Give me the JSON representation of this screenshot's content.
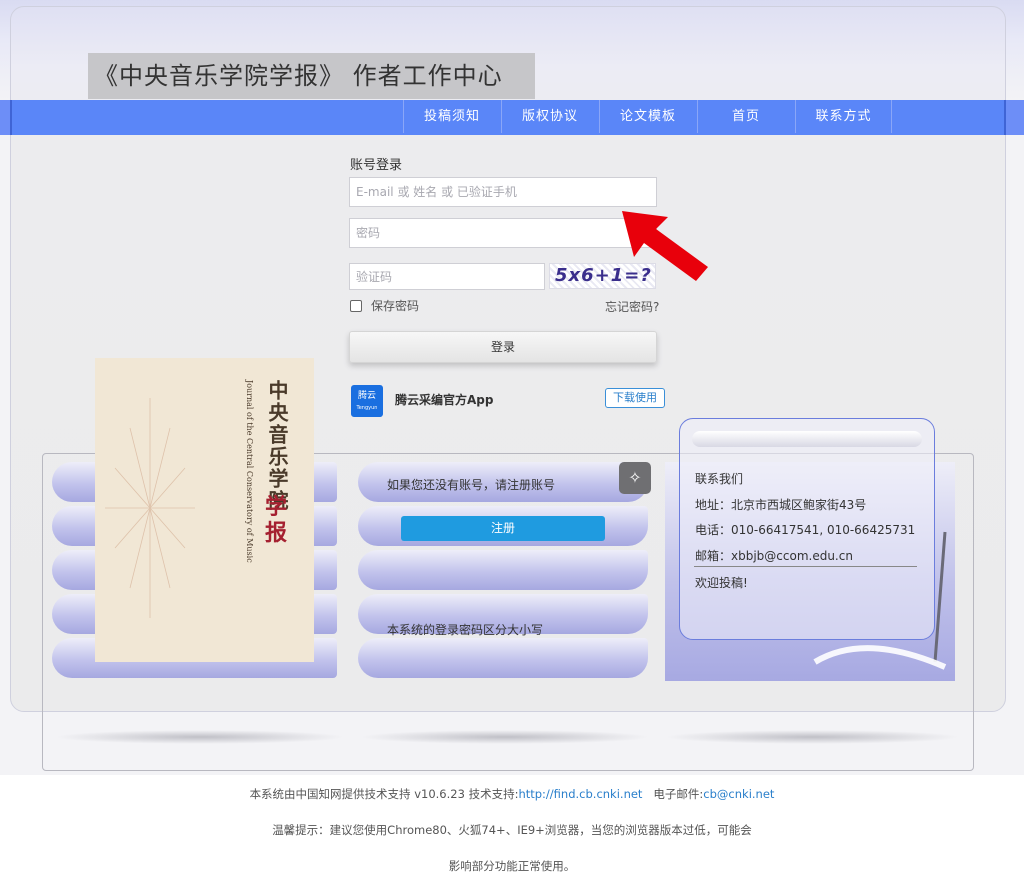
{
  "header": {
    "title": "《中央音乐学院学报》 作者工作中心"
  },
  "nav": {
    "items": [
      "投稿须知",
      "版权协议",
      "论文模板",
      "首页",
      "联系方式"
    ]
  },
  "login": {
    "heading": "账号登录",
    "username_placeholder": "E-mail 或 姓名 或 已验证手机",
    "password_placeholder": "密码",
    "captcha_placeholder": "验证码",
    "captcha_text": "5x6+1=?",
    "remember_label": "保存密码",
    "forgot_label": "忘记密码?",
    "submit_label": "登录"
  },
  "app": {
    "logo_text": "腾云",
    "logo_sub": "Tengyun",
    "name": "腾云采编官方App",
    "download_label": "下载使用"
  },
  "cover": {
    "title": "中央音乐学院",
    "subtitle": "Journal of the Central Conservatory of Music",
    "emphasis": "学报"
  },
  "register": {
    "prompt": "如果您还没有账号，请注册账号",
    "button_label": "注册",
    "case_note": "本系统的登录密码区分大小写"
  },
  "contact": {
    "heading": "联系我们",
    "address": "地址：北京市西城区鲍家街43号",
    "phone": "电话：010-66417541, 010-66425731",
    "email": "邮箱：xbbjb@ccom.edu.cn",
    "welcome": "欢迎投稿!"
  },
  "footer": {
    "support_prefix": "本系统由中国知网提供技术支持 v10.6.23   技术支持:",
    "support_link": "http://find.cb.cnki.net",
    "email_prefix": "   电子邮件:",
    "email_link": "cb@cnki.net",
    "tip_line1": "温馨提示：建议您使用Chrome80、火狐74+、IE9+浏览器，当您的浏览器版本过低，可能会",
    "tip_line2": "影响部分功能正常使用。"
  },
  "colors": {
    "nav_bg": "#5a86f8",
    "register_btn": "#1f9be0",
    "arrow": "#e8000b",
    "link": "#2a7fcb"
  }
}
